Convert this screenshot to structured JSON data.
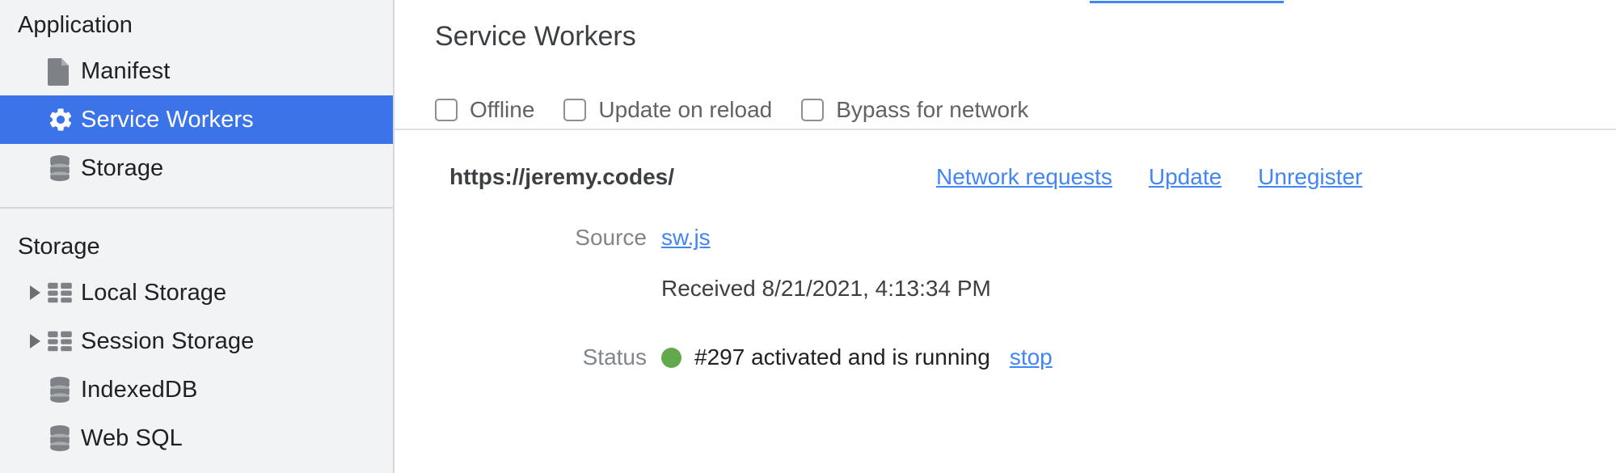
{
  "sidebar": {
    "sections": [
      {
        "title": "Application",
        "items": [
          {
            "label": "Manifest",
            "icon": "document-icon",
            "selected": false,
            "expandable": false
          },
          {
            "label": "Service Workers",
            "icon": "gear-icon",
            "selected": true,
            "expandable": false
          },
          {
            "label": "Storage",
            "icon": "database-icon",
            "selected": false,
            "expandable": false
          }
        ]
      },
      {
        "title": "Storage",
        "items": [
          {
            "label": "Local Storage",
            "icon": "table-icon",
            "selected": false,
            "expandable": true
          },
          {
            "label": "Session Storage",
            "icon": "table-icon",
            "selected": false,
            "expandable": true
          },
          {
            "label": "IndexedDB",
            "icon": "database-icon",
            "selected": false,
            "expandable": false
          },
          {
            "label": "Web SQL",
            "icon": "database-icon",
            "selected": false,
            "expandable": false
          }
        ]
      }
    ]
  },
  "main": {
    "title": "Service Workers",
    "toolbar": {
      "checkboxes": [
        {
          "label": "Offline",
          "checked": false
        },
        {
          "label": "Update on reload",
          "checked": false
        },
        {
          "label": "Bypass for network",
          "checked": false
        }
      ]
    },
    "registration": {
      "origin": "https://jeremy.codes/",
      "actions": [
        {
          "label": "Network requests"
        },
        {
          "label": "Update"
        },
        {
          "label": "Unregister"
        }
      ],
      "fields": {
        "source_label": "Source",
        "source_link": "sw.js",
        "received": "Received 8/21/2021, 4:13:34 PM",
        "status_label": "Status",
        "status_text": "#297 activated and is running",
        "status_action": "stop"
      }
    }
  },
  "colors": {
    "selection_blue": "#3b73e8",
    "link_blue": "#4285f4",
    "status_green": "#62a84c",
    "sidebar_bg": "#f1f3f4"
  }
}
